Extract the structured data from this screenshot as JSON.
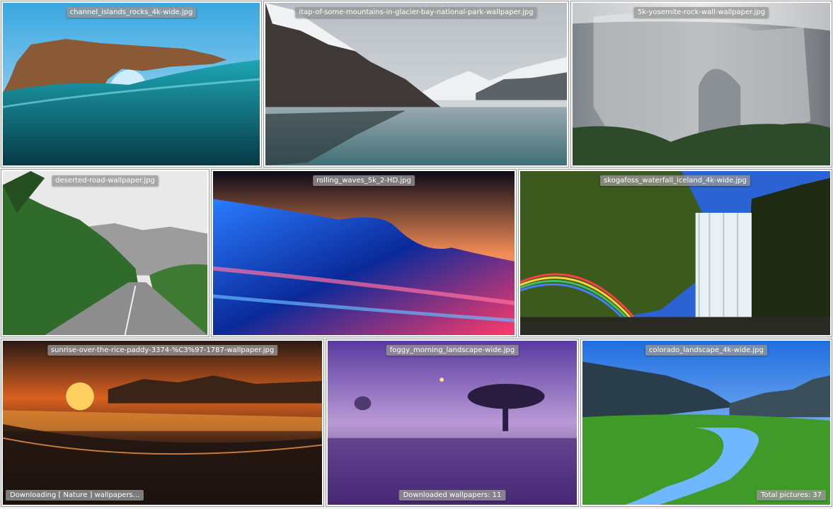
{
  "tiles": [
    {
      "caption": "channel_islands_rocks_4k-wide.jpg"
    },
    {
      "caption": "itap-of-some-mountains-in-glacier-bay-national-park-wallpaper.jpg"
    },
    {
      "caption": "5k-yosemite-rock-wall-wallpaper.jpg"
    },
    {
      "caption": "deserted-road-wallpaper.jpg"
    },
    {
      "caption": "rolling_waves_5k_2-HD.jpg"
    },
    {
      "caption": "skogafoss_waterfall_iceland_4k-wide.jpg"
    },
    {
      "caption": "sunrise-over-the-rice-paddy-3374-%C3%97-1787-wallpaper.jpg"
    },
    {
      "caption": "foggy_morning_landscape-wide.jpg"
    },
    {
      "caption": "colorado_landscape_4k-wide.jpg"
    }
  ],
  "status": {
    "downloading": "Downloading [ Nature ] wallpapers...",
    "downloaded": "Downloaded wallpapers: 11",
    "total": "Total pictures: 37"
  }
}
